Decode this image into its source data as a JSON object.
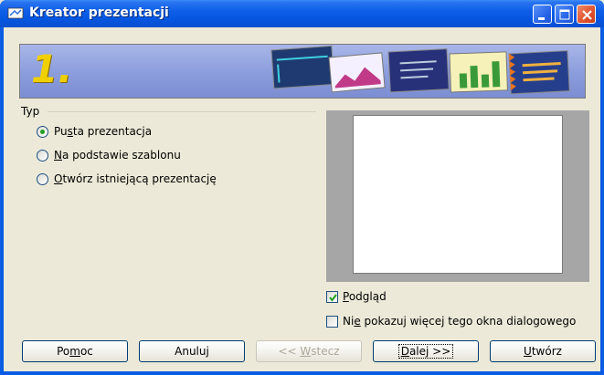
{
  "window": {
    "title": "Kreator prezentacji"
  },
  "banner": {
    "step_number": "1."
  },
  "type_group": {
    "label": "Typ",
    "options": [
      {
        "pre": "Pu",
        "acc": "s",
        "post": "ta prezentacja",
        "checked": true
      },
      {
        "pre": "",
        "acc": "N",
        "post": "a podstawie szablonu",
        "checked": false
      },
      {
        "pre": "",
        "acc": "O",
        "post": "twórz istniejącą prezentację",
        "checked": false
      }
    ]
  },
  "checkboxes": {
    "preview": {
      "pre": "",
      "acc": "P",
      "post": "odgląd",
      "checked": true
    },
    "dont_show": {
      "pre": "Ni",
      "acc": "e",
      "post": " pokazuj więcej tego okna dialogowego",
      "checked": false
    }
  },
  "buttons": {
    "help": {
      "pre": "Po",
      "acc": "m",
      "post": "oc"
    },
    "cancel": {
      "pre": "Anuluj",
      "acc": "",
      "post": ""
    },
    "back": {
      "pre": "<< ",
      "acc": "W",
      "post": "stecz"
    },
    "next": {
      "pre": "",
      "acc": "D",
      "post": "alej >>"
    },
    "create": {
      "pre": "",
      "acc": "U",
      "post": "twórz"
    }
  },
  "colors": {
    "titlebar": "#0a5ce4",
    "dialog_bg": "#ece9d8",
    "banner": "#8a9cdc",
    "step_number": "#f0d000",
    "radio_dot": "#21a121"
  }
}
